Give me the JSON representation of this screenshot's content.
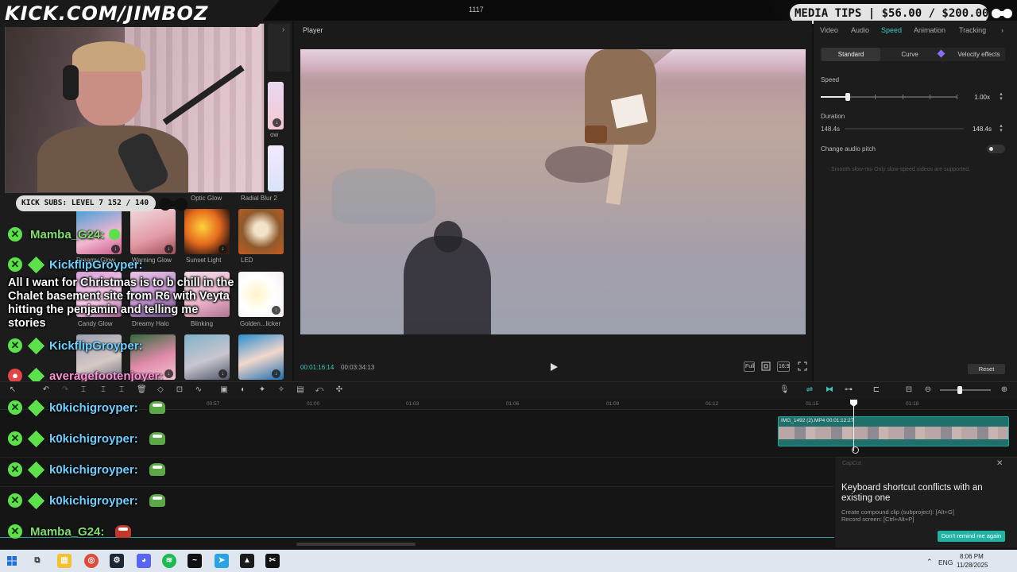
{
  "app": {
    "title": "1117"
  },
  "overlay": {
    "brand": "KICK.COM/JIMBOZ",
    "media_tips": "MEDIA TIPS | $56.00 / $200.00",
    "subs": "KICK SUBS: LEVEL 7 152 / 140"
  },
  "media_panel": {
    "items": [
      {
        "label": "Dreamy Glow"
      },
      {
        "label": "Warning Glow"
      },
      {
        "label": "Sunset Light"
      },
      {
        "label": "LED"
      },
      {
        "label": "Candy Glow"
      },
      {
        "label": "Dreamy Halo"
      },
      {
        "label": "Blinking"
      },
      {
        "label": "Golden...licker"
      },
      {
        "label": "ow"
      },
      {
        "label": "Radial Blur 2"
      },
      {
        "label": "Optic Glow"
      }
    ]
  },
  "chat": {
    "lines": [
      {
        "user": "Mamba_G24:"
      },
      {
        "user": "KickflipGroyper:"
      },
      {
        "user": "KickflipGroyper:"
      },
      {
        "user": "averagefootenjoyer:"
      },
      {
        "user": "k0kichigroyper:"
      },
      {
        "user": "k0kichigroyper:"
      },
      {
        "user": "k0kichigroyper:"
      },
      {
        "user": "k0kichigroyper:"
      },
      {
        "user": "Mamba_G24:"
      }
    ],
    "message": "All I want for Christmas is to b chill in the Chalet basement site from R6 with Veyta hitting the penjamin and telling me stories"
  },
  "player": {
    "title": "Player",
    "current_time": "00:01:16:14",
    "total_time": "00:03:34:13",
    "controls": {
      "full": "Full",
      "ratio": "16:9"
    }
  },
  "inspector": {
    "tabs": [
      "Video",
      "Audio",
      "Speed",
      "Animation",
      "Tracking"
    ],
    "active_tab": "Speed",
    "modes": [
      "Standard",
      "Curve",
      "Velocity effects"
    ],
    "active_mode": "Standard",
    "speed_label": "Speed",
    "speed_value": "1.00x",
    "speed_level": 0.2,
    "duration_label": "Duration",
    "duration_from": "148.4s",
    "duration_value": "148.4s",
    "pitch_label": "Change audio pitch",
    "hint": "Smooth slow-mo  Only slow-speed videos are supported.",
    "reset": "Reset"
  },
  "timeline": {
    "ruler": [
      "00:57",
      "01:00",
      "01:03",
      "01:06",
      "01:09",
      "01:12",
      "01:15",
      "01:18"
    ],
    "clip_label": "IMG_1492 (2).MP4   00:01:12:27"
  },
  "toast": {
    "brand": "CapCut",
    "title": "Keyboard shortcut conflicts with an existing one",
    "line1": "Create compound clip (subproject): [Alt+G]",
    "line2": "Record screen: [Ctrl+Alt+P]",
    "button": "Don't remind me again"
  },
  "taskbar": {
    "lang": "ENG",
    "time": "8:06 PM",
    "date": "11/28/2025"
  },
  "colors": {
    "accent": "#3fc9c2",
    "chat_green": "#5de14a",
    "chat_blue": "#6bd0ff"
  }
}
